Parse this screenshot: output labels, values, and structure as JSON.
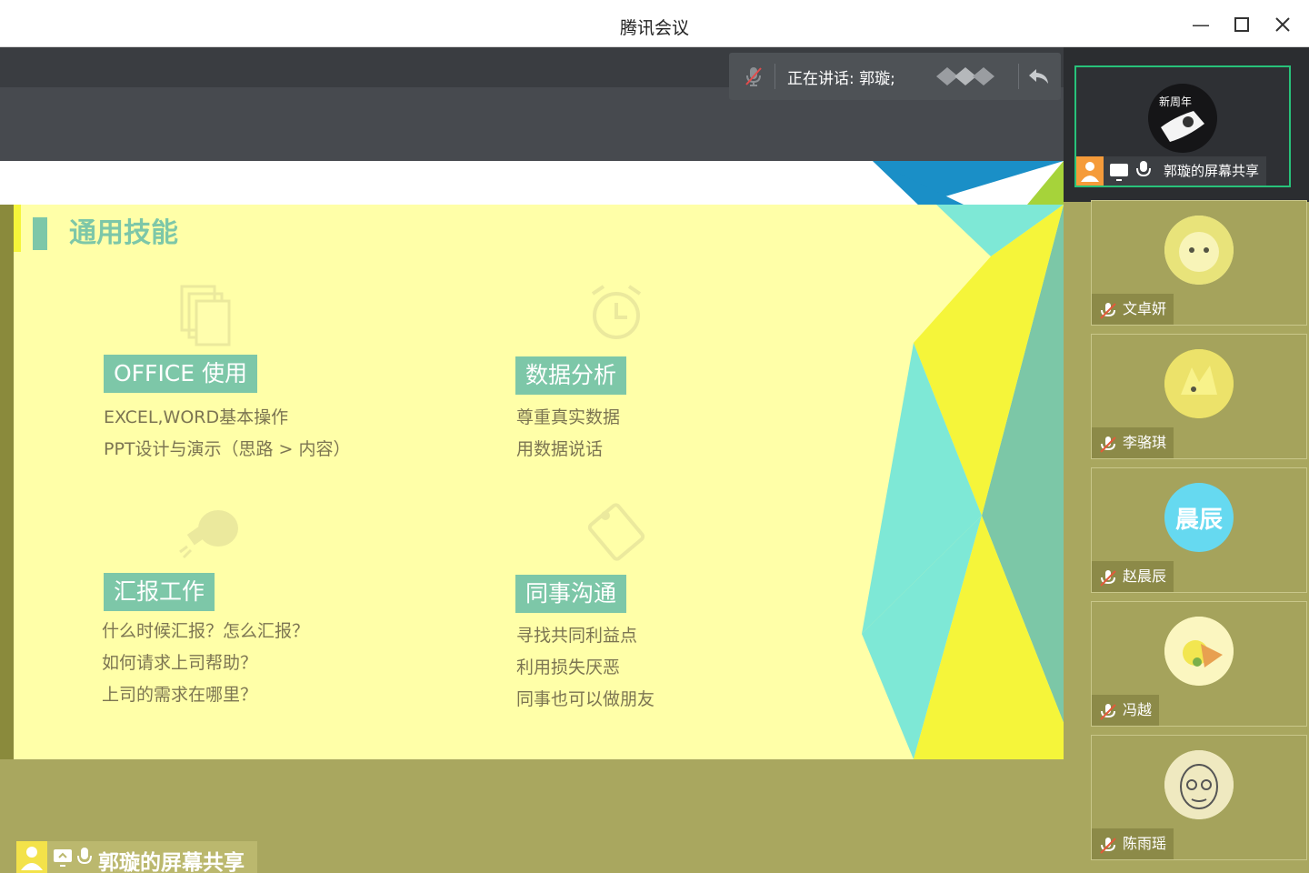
{
  "window": {
    "title": "腾讯会议",
    "controls": [
      "minimize-icon",
      "maximize-icon",
      "close-icon"
    ]
  },
  "toolbar": {
    "speaking_text": "正在讲话: 郭璇;",
    "icons": [
      "mic-muted-icon",
      "reply-icon"
    ]
  },
  "slide": {
    "heading": "通用技能",
    "sections": [
      {
        "tag": "OFFICE 使用",
        "items": [
          "EXCEL,WORD基本操作",
          "PPT设计与演示（思路 > 内容）"
        ],
        "ghost_icon": "documents-icon"
      },
      {
        "tag": "数据分析",
        "items": [
          "尊重真实数据",
          "用数据说话"
        ],
        "ghost_icon": "alarm-clock-icon"
      },
      {
        "tag": "汇报工作",
        "items": [
          "什么时候汇报？怎么汇报？",
          "如何请求上司帮助？",
          "上司的需求在哪里？"
        ],
        "ghost_icon": "lightbulb-icon"
      },
      {
        "tag": "同事沟通",
        "items": [
          "寻找共同利益点",
          "利用损失厌恶",
          "同事也可以做朋友"
        ],
        "ghost_icon": "tag-icon"
      }
    ]
  },
  "share_label": "郭璇的屏幕共享",
  "participants": [
    {
      "name": "郭璇的屏幕共享",
      "active": true,
      "avatar_text": "新周年"
    },
    {
      "name": "文卓妍",
      "active": false
    },
    {
      "name": "李骆琪",
      "active": false
    },
    {
      "name": "赵晨辰",
      "active": false,
      "avatar_text": "晨辰",
      "avatar_color": "#66d9f0"
    },
    {
      "name": "冯越",
      "active": false
    },
    {
      "name": "陈雨瑶",
      "active": false
    }
  ],
  "colors": {
    "accent_green": "#7dc7a8",
    "active_border": "#28c27a",
    "slide_bg": "#ffffa8",
    "panel_bg": "#a9a75f"
  }
}
